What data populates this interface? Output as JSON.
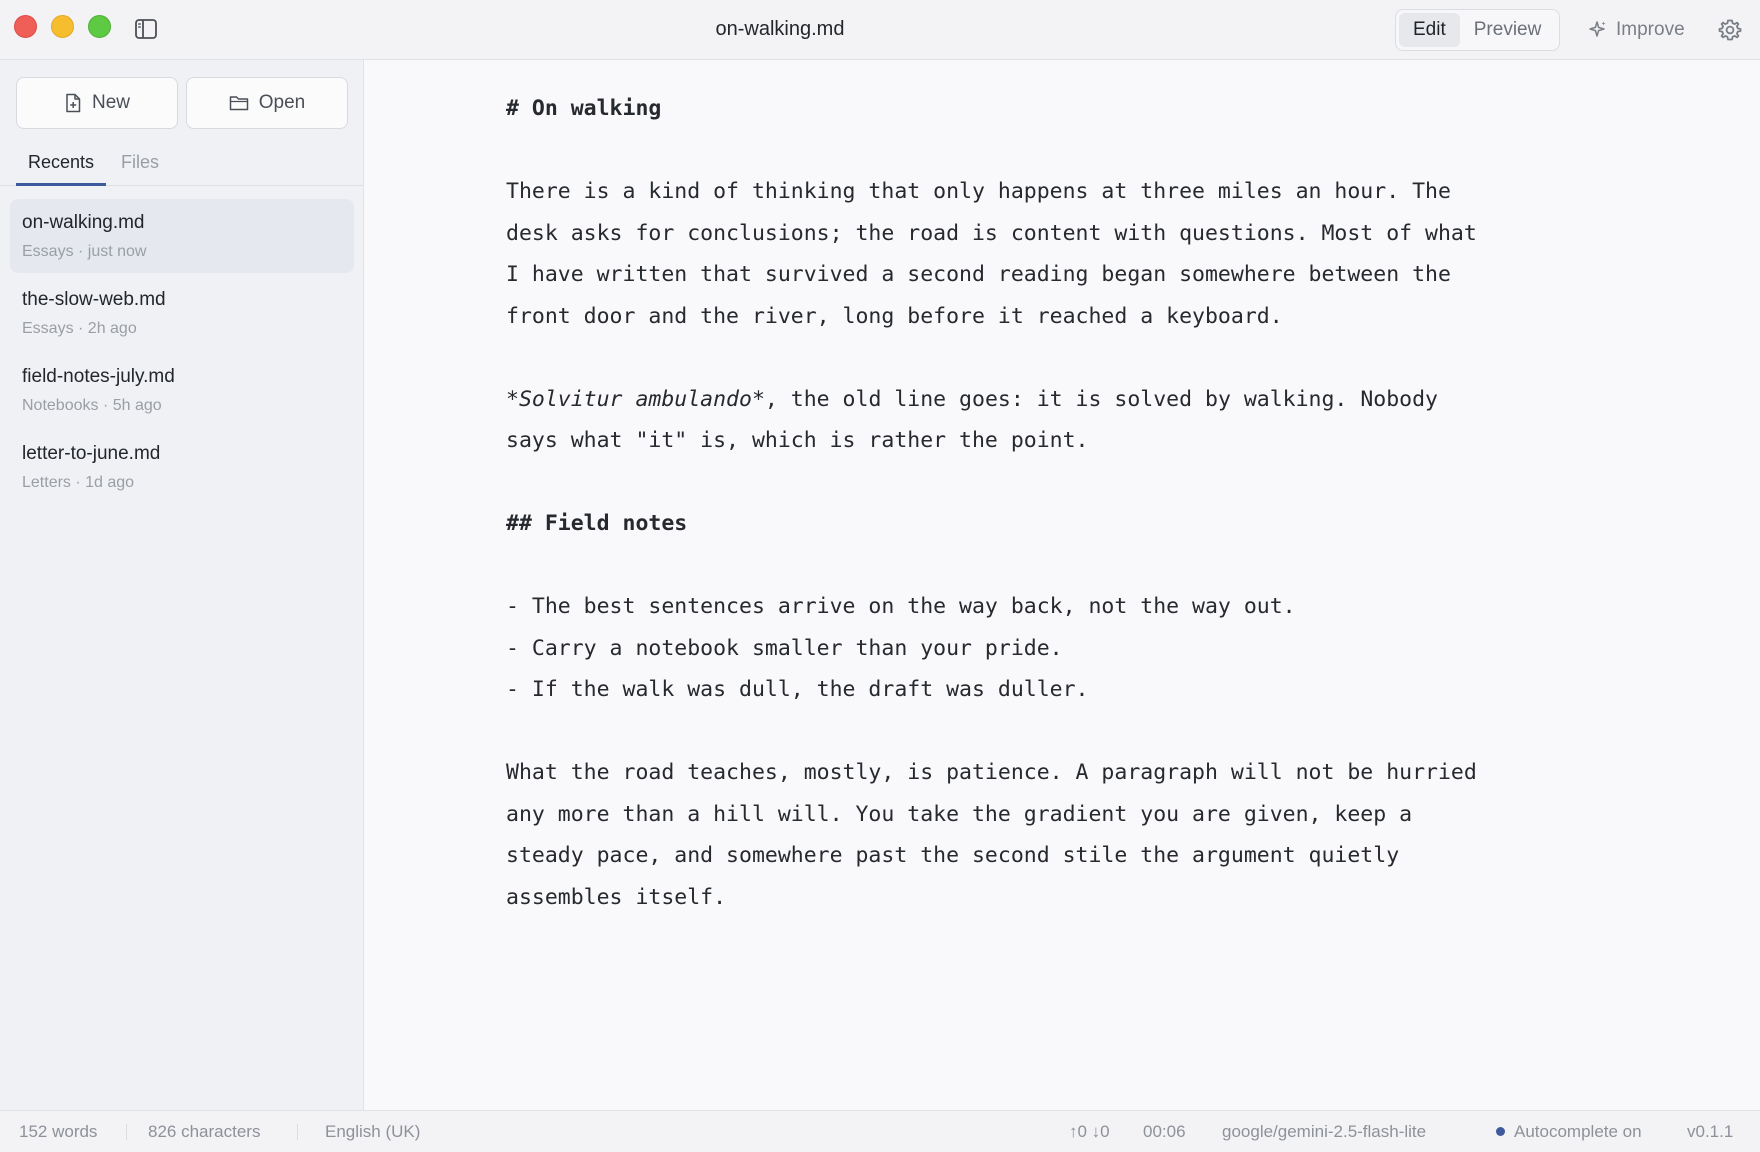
{
  "window": {
    "title": "on-walking.md"
  },
  "toolbar": {
    "edit_label": "Edit",
    "preview_label": "Preview",
    "improve_label": "Improve"
  },
  "sidebar": {
    "new_label": "New",
    "open_label": "Open",
    "tabs": [
      {
        "label": "Recents"
      },
      {
        "label": "Files"
      }
    ],
    "files": [
      {
        "name": "on-walking.md",
        "meta": "Essays · just now"
      },
      {
        "name": "the-slow-web.md",
        "meta": "Essays · 2h ago"
      },
      {
        "name": "field-notes-july.md",
        "meta": "Notebooks · 5h ago"
      },
      {
        "name": "letter-to-june.md",
        "meta": "Letters · 1d ago"
      }
    ]
  },
  "editor": {
    "lines": [
      "# On walking",
      "",
      "There is a kind of thinking that only happens at three miles an hour. The",
      "desk asks for conclusions; the road is content with questions. Most of what",
      "I have written that survived a second reading began somewhere between the",
      "front door and the river, long before it reached a keyboard.",
      "",
      "*Solvitur ambulando*, the old line goes: it is solved by walking. Nobody",
      "says what \"it\" is, which is rather the point.",
      "",
      "## Field notes",
      "",
      "- The best sentences arrive on the way back, not the way out.",
      "- Carry a notebook smaller than your pride.",
      "- If the walk was dull, the draft was duller.",
      "",
      "What the road teaches, mostly, is patience. A paragraph will not be hurried",
      "any more than a hill will. You take the gradient you are given, keep a",
      "steady pace, and somewhere past the second stile the argument quietly",
      "assembles itself."
    ]
  },
  "status": {
    "words": "152 words",
    "characters": "826 characters",
    "language": "English (UK)",
    "sync": "↑0 ↓0",
    "time": "00:06",
    "model": "google/gemini-2.5-flash-lite",
    "autocomplete": "Autocomplete on",
    "version": "v0.1.1"
  },
  "colors": {
    "accent": "#3d5a9c",
    "close": "#ef5f57",
    "minimize": "#f6be2f",
    "zoom": "#5ec942"
  }
}
